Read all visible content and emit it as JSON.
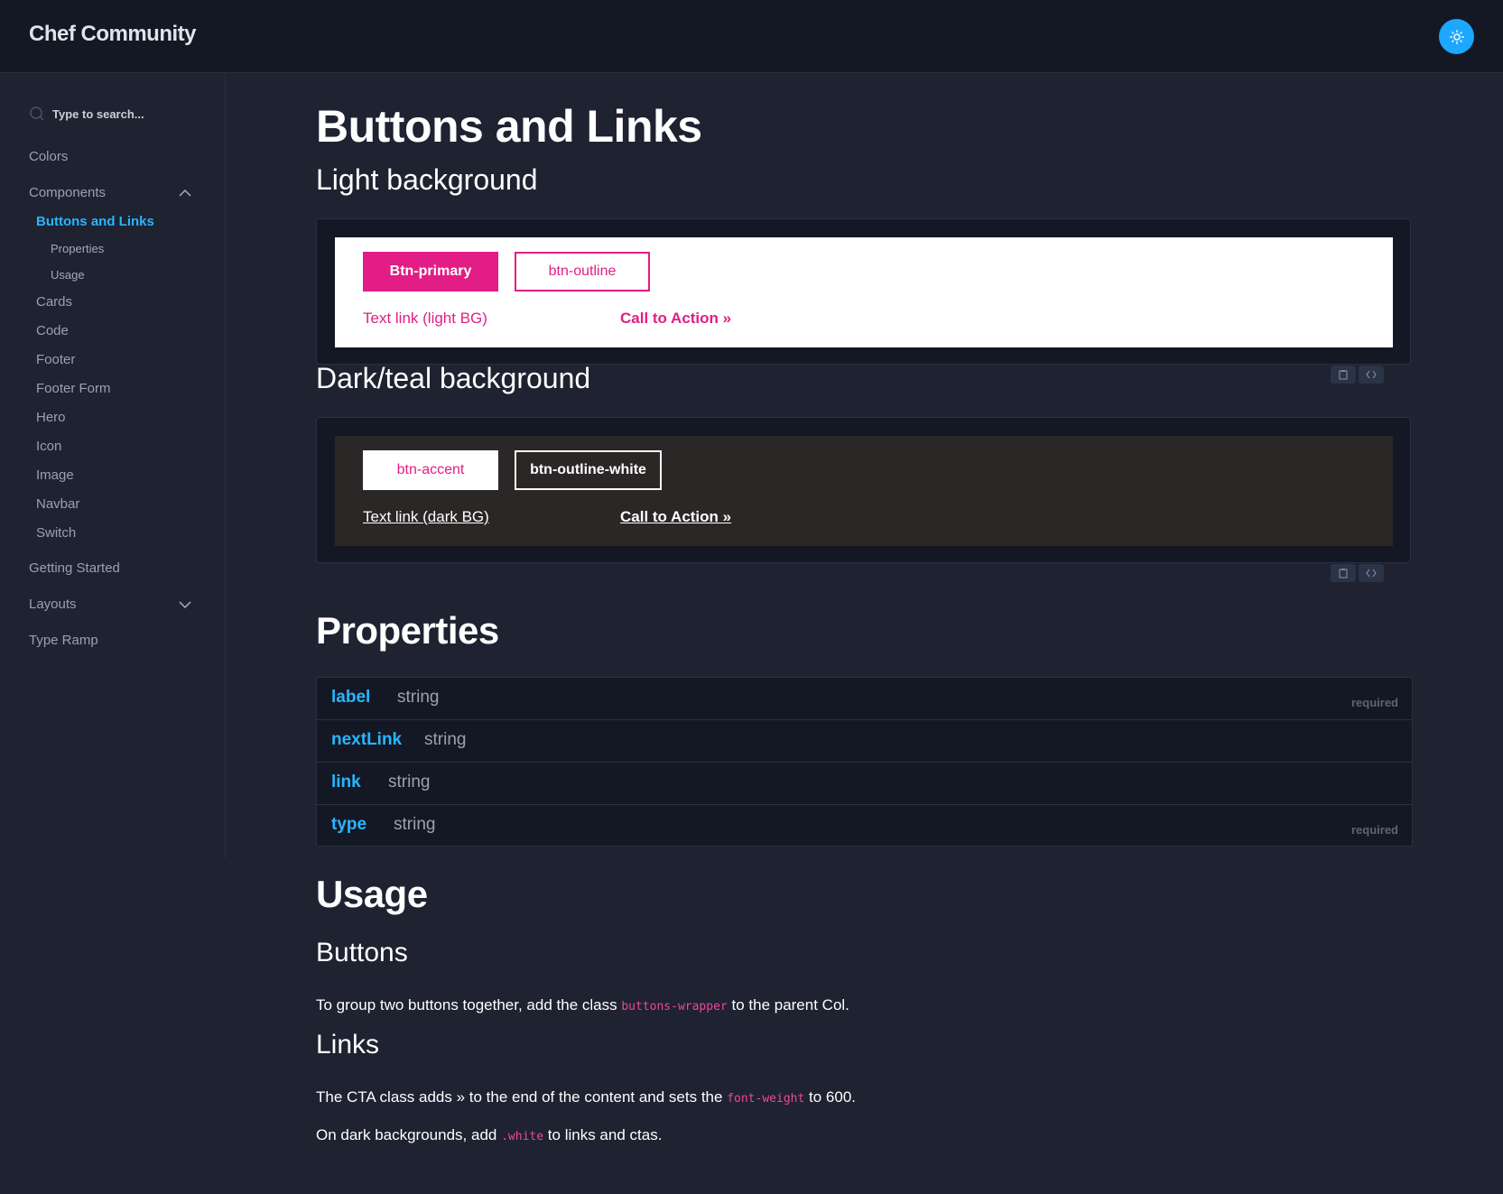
{
  "header": {
    "brand": "Chef Community",
    "theme_icon": "sun-icon"
  },
  "sidebar": {
    "search_placeholder": "Type to search...",
    "items": {
      "colors": "Colors",
      "components": "Components",
      "buttons_links": "Buttons and Links",
      "properties": "Properties",
      "usage": "Usage",
      "cards": "Cards",
      "code": "Code",
      "footer": "Footer",
      "footer_form": "Footer Form",
      "hero": "Hero",
      "icon": "Icon",
      "image": "Image",
      "navbar": "Navbar",
      "switch": "Switch",
      "getting_started": "Getting Started",
      "layouts": "Layouts",
      "type_ramp": "Type Ramp"
    }
  },
  "main": {
    "title": "Buttons and Links",
    "light_heading": "Light background",
    "light": {
      "btn_primary": "Btn-primary",
      "btn_outline": "btn-outline",
      "text_link": "Text link (light BG)",
      "cta": "Call to Action »"
    },
    "dark_heading": "Dark/teal background",
    "dark": {
      "btn_accent": "btn-accent",
      "btn_outline_white": "btn-outline-white",
      "text_link": "Text link (dark BG)",
      "cta": "Call to Action »"
    },
    "properties_heading": "Properties",
    "properties": [
      {
        "name": "label",
        "type": "string",
        "required": "required"
      },
      {
        "name": "nextLink",
        "type": "string",
        "required": ""
      },
      {
        "name": "link",
        "type": "string",
        "required": ""
      },
      {
        "name": "type",
        "type": "string",
        "required": "required"
      }
    ],
    "usage_heading": "Usage",
    "buttons_heading": "Buttons",
    "buttons_text_a": "To group two buttons together, add the class",
    "buttons_code": "buttons-wrapper",
    "buttons_text_b": "to the parent Col.",
    "links_heading": "Links",
    "links_text_a": "The CTA class adds » to the end of the content and sets the",
    "links_code": "font-weight",
    "links_text_b": "to 600.",
    "links2_text_a": "On dark backgrounds, add",
    "links2_code": ".white",
    "links2_text_b": "to links and ctas."
  },
  "colors": {
    "accent_pink": "#e21d85",
    "link_blue": "#28b6ff",
    "bg": "#1e2231"
  }
}
